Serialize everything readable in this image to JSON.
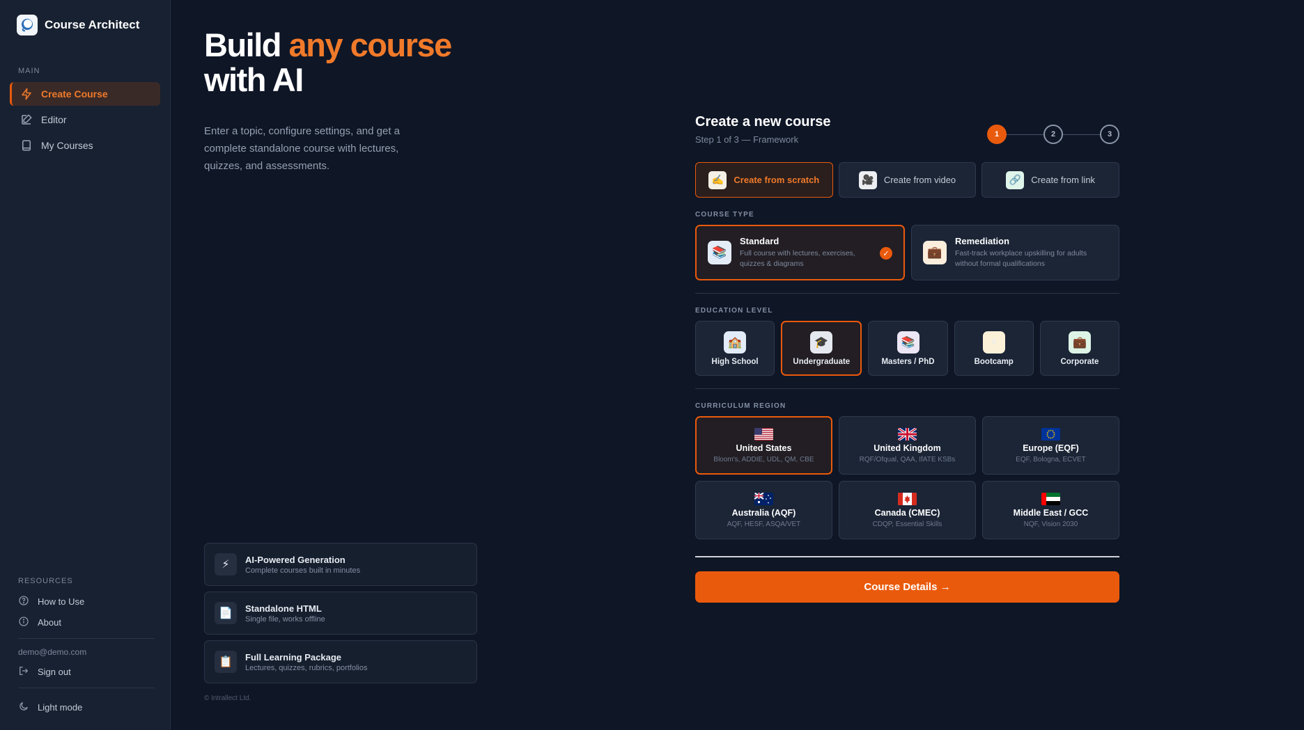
{
  "app": {
    "name": "Course Architect"
  },
  "sidebar": {
    "section_main": "MAIN",
    "items": [
      {
        "label": "Create Course",
        "icon": "lightning-icon",
        "active": true
      },
      {
        "label": "Editor",
        "icon": "edit-icon",
        "active": false
      },
      {
        "label": "My Courses",
        "icon": "book-icon",
        "active": false
      }
    ],
    "section_resources": "RESOURCES",
    "resources": [
      {
        "label": "How to Use",
        "icon": "help-circle-icon"
      },
      {
        "label": "About",
        "icon": "info-circle-icon"
      }
    ],
    "user_email": "demo@demo.com",
    "sign_out": "Sign out",
    "theme_toggle": "Light mode"
  },
  "hero": {
    "title_part1": "Build ",
    "title_accent": "any course",
    "title_part2": "with AI",
    "subtitle": "Enter a topic, configure settings, and get a complete standalone course with lectures, quizzes, and assessments."
  },
  "features": [
    {
      "icon": "⚡",
      "title": "AI-Powered Generation",
      "desc": "Complete courses built in minutes"
    },
    {
      "icon": "📄",
      "title": "Standalone HTML",
      "desc": "Single file, works offline"
    },
    {
      "icon": "📋",
      "title": "Full Learning Package",
      "desc": "Lectures, quizzes, rubrics, portfolios"
    }
  ],
  "copyright": "© Intrallect Ltd.",
  "form": {
    "title": "Create a new course",
    "step_text": "Step 1 of 3 — Framework",
    "steps": [
      "1",
      "2",
      "3"
    ],
    "sources": [
      {
        "label": "Create from scratch",
        "icon": "✍️",
        "bg": "#f5f0e6",
        "selected": true
      },
      {
        "label": "Create from video",
        "icon": "🎥",
        "bg": "#eceef2",
        "selected": false
      },
      {
        "label": "Create from link",
        "icon": "🔗",
        "bg": "#dff5ea",
        "selected": false
      }
    ],
    "course_type_label": "COURSE TYPE",
    "course_types": [
      {
        "title": "Standard",
        "desc": "Full course with lectures, exercises, quizzes & diagrams",
        "icon": "📚",
        "bg": "#e4ecf8",
        "selected": true
      },
      {
        "title": "Remediation",
        "desc": "Fast-track workplace upskilling for adults without formal qualifications",
        "icon": "💼",
        "bg": "#fbeedd",
        "selected": false
      }
    ],
    "check_mark": "✓",
    "education_level_label": "EDUCATION LEVEL",
    "levels": [
      {
        "label": "High School",
        "icon": "🏫",
        "bg": "#e2ecf9",
        "selected": false
      },
      {
        "label": "Undergraduate",
        "icon": "🎓",
        "bg": "#e6e8f0",
        "selected": true
      },
      {
        "label": "Masters / PhD",
        "icon": "📚",
        "bg": "#ece6f5",
        "selected": false
      },
      {
        "label": "Bootcamp",
        "icon": "⚡",
        "bg": "#fbf1d8",
        "selected": false
      },
      {
        "label": "Corporate",
        "icon": "💼",
        "bg": "#ddf3e6",
        "selected": false
      }
    ],
    "region_label": "CURRICULUM REGION",
    "regions": [
      {
        "name": "United States",
        "desc": "Bloom's, ADDIE, UDL, QM, CBE",
        "flag": "us",
        "selected": true
      },
      {
        "name": "United Kingdom",
        "desc": "RQF/Ofqual, QAA, IfATE KSBs",
        "flag": "uk",
        "selected": false
      },
      {
        "name": "Europe (EQF)",
        "desc": "EQF, Bologna, ECVET",
        "flag": "eu",
        "selected": false
      },
      {
        "name": "Australia (AQF)",
        "desc": "AQF, HESF, ASQA/VET",
        "flag": "au",
        "selected": false
      },
      {
        "name": "Canada (CMEC)",
        "desc": "CDQP, Essential Skills",
        "flag": "ca",
        "selected": false
      },
      {
        "name": "Middle East / GCC",
        "desc": "NQF, Vision 2030",
        "flag": "ae",
        "selected": false
      }
    ],
    "next_button": "Course Details →"
  },
  "colors": {
    "accent": "#ea5a0c",
    "accent_text": "#f07a2a",
    "bg": "#0f1626",
    "sidebar": "#172131"
  }
}
